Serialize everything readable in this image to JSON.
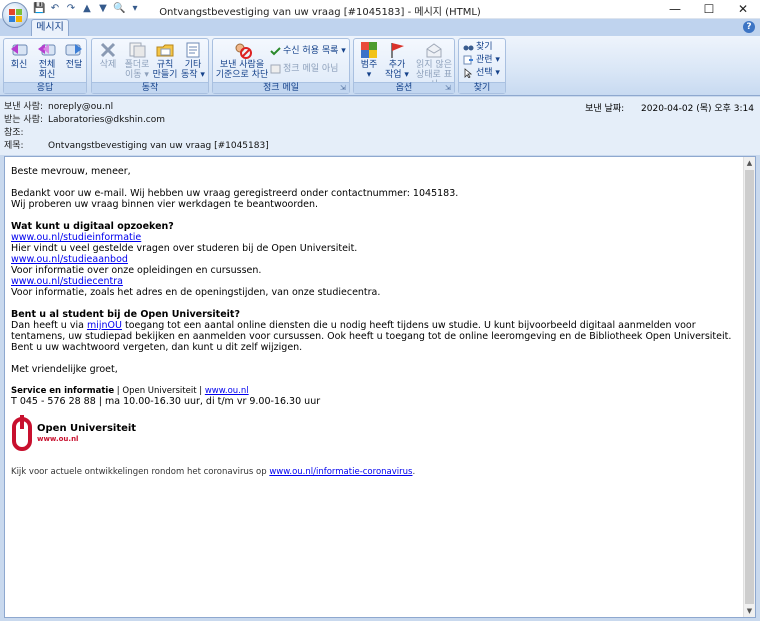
{
  "window": {
    "title": "Ontvangstbevestiging van uw vraag [#1045183] - 메시지 (HTML)",
    "controls": [
      "—",
      "☐",
      "✕"
    ]
  },
  "ribbon": {
    "active_tab": "메시지",
    "groups": [
      {
        "label": "응답",
        "buttons": [
          {
            "icon": "reply-icon",
            "label": "회신"
          },
          {
            "icon": "reply-all-icon",
            "label": "전체\n회신"
          },
          {
            "icon": "forward-icon",
            "label": "전달"
          }
        ]
      },
      {
        "label": "동작",
        "buttons": [
          {
            "icon": "delete-icon",
            "label": "삭제"
          },
          {
            "icon": "move-to-folder-icon",
            "label": "폴더로\n이동 ▾"
          },
          {
            "icon": "rules-icon",
            "label": "규칙\n만들기"
          },
          {
            "icon": "other-actions-icon",
            "label": "기타\n동작 ▾"
          }
        ]
      },
      {
        "label": "정크 메일",
        "block_sender": "보낸 사람을\n기준으로 차단",
        "safe_list": "수신 허용 목록 ▾",
        "not_junk": "정크 메일 아님"
      },
      {
        "label": "옵션",
        "buttons": [
          {
            "icon": "categorize-icon",
            "label": "범주\n▾"
          },
          {
            "icon": "follow-up-flag-icon",
            "label": "추가\n작업 ▾"
          },
          {
            "icon": "mark-unread-icon",
            "label": "읽지 않은\n상태로 표시"
          }
        ]
      },
      {
        "label": "찾기",
        "items": [
          "찾기",
          "관련 ▾",
          "선택 ▾"
        ]
      }
    ]
  },
  "header": {
    "from_label": "보낸 사람:",
    "from": "noreply@ou.nl",
    "to_label": "받는 사람:",
    "to": "Laboratories@dkshin.com",
    "cc_label": "참조:",
    "cc": "",
    "subject_label": "제목:",
    "subject": "Ontvangstbevestiging van uw vraag [#1045183]",
    "sent_label": "보낸 날짜:",
    "sent": "2020-04-02 (목) 오후 3:14"
  },
  "mail": {
    "greeting": "Beste mevrouw, meneer,",
    "intro1": "Bedankt voor uw e-mail. Wij hebben uw vraag geregistreerd onder contactnummer: 1045183.",
    "intro2": "Wij proberen uw vraag binnen vier werkdagen te beantwoorden.",
    "h1": "Wat kunt u digitaal opzoeken?",
    "link1": "www.ou.nl/studieinformatie",
    "text1": "Hier vindt u veel gestelde vragen over studeren bij de Open Universiteit.",
    "link2": "www.ou.nl/studieaanbod",
    "text2": "Voor informatie over onze opleidingen en cursussen.",
    "link3": "www.ou.nl/studiecentra",
    "text3": "Voor informatie, zoals het adres en de openingstijden, van onze studiecentra.",
    "h2": "Bent u al student bij de Open Universiteit?",
    "p2a": "Dan heeft u via ",
    "link4": "mijnOU",
    "p2b": " toegang tot een aantal online diensten die u nodig heeft tijdens uw studie. U kunt bijvoorbeeld digitaal aanmelden voor tentamens, uw studiepad bekijken en aanmelden voor cursussen. Ook heeft u toegang tot de online leeromgeving en de Bibliotheek Open Universiteit.",
    "p2c": "Bent u uw wachtwoord vergeten, dan kunt u dit zelf wijzigen.",
    "closing": "Met vriendelijke groet,",
    "sig_bold": "Service en informatie",
    "sig_mid": " | Open Universiteit | ",
    "sig_link": "www.ou.nl",
    "sig_phone": "T 045 - 576 28 88 | ma 10.00-16.30 uur, di t/m vr 9.00-16.30 uur",
    "logo_name": "Open Universiteit",
    "logo_url": "www.ou.nl",
    "foot_text": "Kijk voor actuele ontwikkelingen rondom het coronavirus op ",
    "foot_link": "www.ou.nl/informatie-coronavirus",
    "foot_end": "."
  },
  "colors": {
    "accent": "#15428b",
    "ou_red": "#c8102e",
    "link": "#0000ee"
  }
}
